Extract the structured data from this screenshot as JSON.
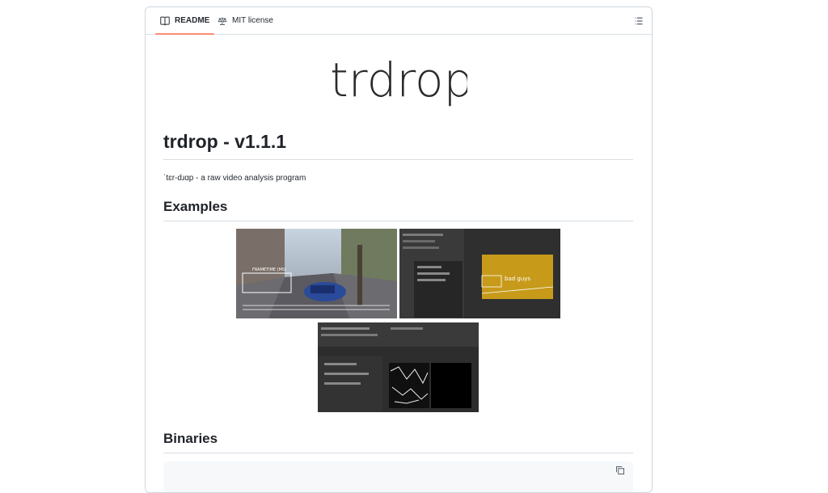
{
  "tabs": [
    {
      "label": "README",
      "icon": "book-icon"
    },
    {
      "label": "MIT license",
      "icon": "scale-icon"
    }
  ],
  "outline_icon": "list-icon",
  "logo_text": "trdrop",
  "title": "trdrop - v1.1.1",
  "pronunciation": "ˈtɛr-dɹɑp - a raw video analysis program",
  "sections": {
    "examples": "Examples",
    "binaries": "Binaries"
  },
  "screenshots": [
    {
      "alt": "example-gameplay-overlay"
    },
    {
      "alt": "example-settings-overlay"
    },
    {
      "alt": "example-edge-detection"
    }
  ],
  "shot_labels": {
    "overlay_text": "FRAMETIME (MS)",
    "bad_guys": "bad guys"
  },
  "colors": {
    "tab_underline": "#fd8c73",
    "border": "#d0d7de"
  }
}
